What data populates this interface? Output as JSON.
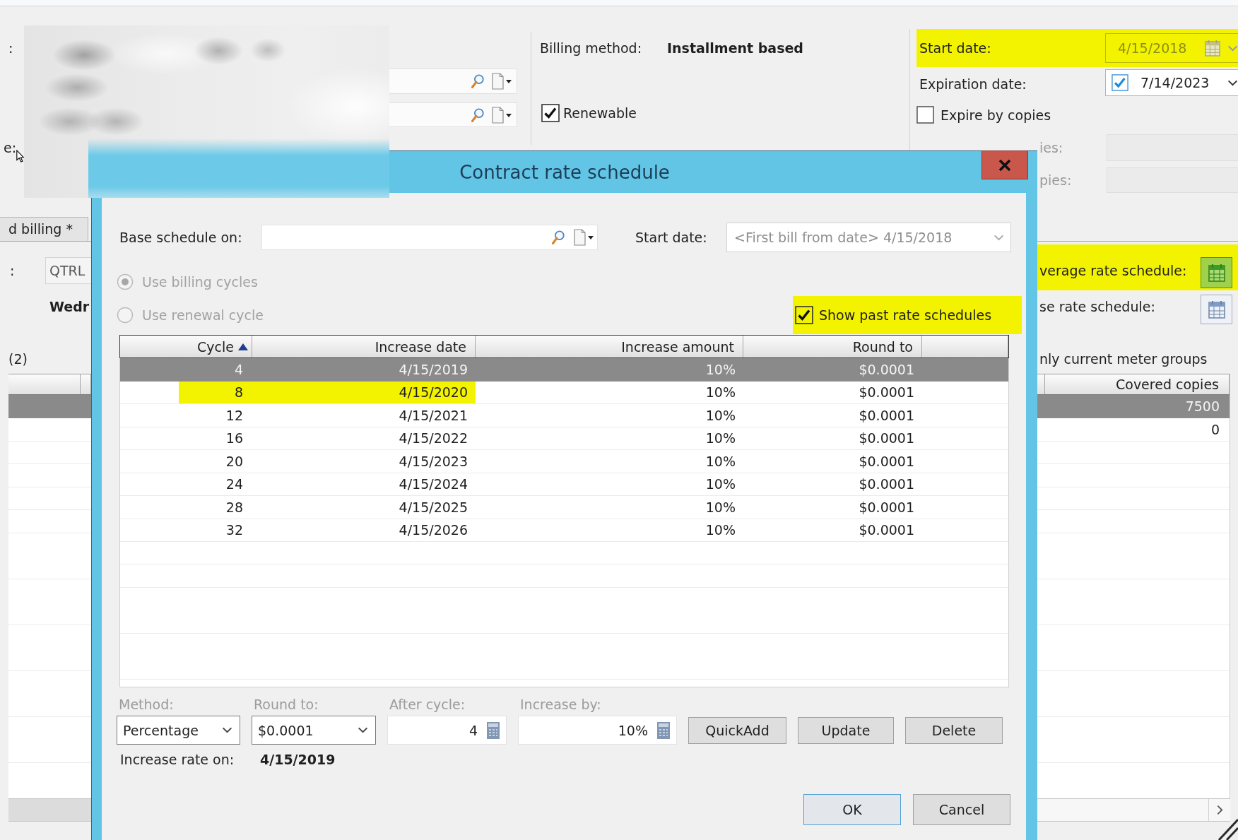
{
  "contract_form": {
    "label_fragments": [
      ":",
      "e:"
    ],
    "billing_method": {
      "label": "Billing method:",
      "value": "Installment based"
    },
    "renewable": {
      "label": "Renewable",
      "checked": true
    },
    "start_date": {
      "label": "Start date:",
      "value": "4/15/2018",
      "disabled": true,
      "highlighted": true
    },
    "expiration_date": {
      "label": "Expiration date:",
      "value": "7/14/2023",
      "checked": true
    },
    "expire_by_copies": {
      "label": "Expire by copies",
      "checked": false
    },
    "copies_fields": [
      {
        "label": "ies:",
        "disabled": true
      },
      {
        "label": "pies:",
        "disabled": true
      }
    ],
    "tabs": [
      {
        "label": "d billing *",
        "selected": false
      }
    ],
    "schedule": {
      "label": ":",
      "value": "QTRL"
    },
    "day": "Wedr",
    "meter_groups_count": "(2)",
    "coverage_rate_schedule": {
      "label": "verage rate schedule:",
      "highlighted": true
    },
    "increase_rate_schedule": {
      "label": "se rate schedule:"
    },
    "current_meter_groups": "nly current meter groups",
    "meter_groups_table": {
      "columns": [
        "Covered copies"
      ],
      "rows": [
        {
          "cells": [
            "7500"
          ],
          "selected": true
        },
        {
          "cells": [
            "0"
          ],
          "selected": false
        }
      ]
    }
  },
  "dialog": {
    "title": "Contract rate schedule",
    "base_schedule_on": {
      "label": "Base schedule on:"
    },
    "start_date": {
      "label": "Start date:",
      "value": "<First bill from date> 4/15/2018",
      "disabled": true
    },
    "basis_options": [
      {
        "label": "Use billing cycles",
        "selected": true,
        "disabled": true
      },
      {
        "label": "Use renewal cycle",
        "selected": false,
        "disabled": true
      }
    ],
    "show_past_rate_schedules": {
      "label": "Show past rate schedules",
      "checked": true,
      "highlighted": true
    },
    "table": {
      "columns": [
        {
          "label": "Cycle",
          "sorted": true
        },
        {
          "label": "Increase date",
          "sorted": false
        },
        {
          "label": "Increase amount",
          "sorted": false
        },
        {
          "label": "Round to",
          "sorted": false
        }
      ],
      "rows": [
        {
          "cells": [
            "4",
            "4/15/2019",
            "10%",
            "$0.0001"
          ],
          "selected": true,
          "highlighted": false
        },
        {
          "cells": [
            "8",
            "4/15/2020",
            "10%",
            "$0.0001"
          ],
          "selected": false,
          "highlighted": true
        },
        {
          "cells": [
            "12",
            "4/15/2021",
            "10%",
            "$0.0001"
          ],
          "selected": false,
          "highlighted": false
        },
        {
          "cells": [
            "16",
            "4/15/2022",
            "10%",
            "$0.0001"
          ],
          "selected": false,
          "highlighted": false
        },
        {
          "cells": [
            "20",
            "4/15/2023",
            "10%",
            "$0.0001"
          ],
          "selected": false,
          "highlighted": false
        },
        {
          "cells": [
            "24",
            "4/15/2024",
            "10%",
            "$0.0001"
          ],
          "selected": false,
          "highlighted": false
        },
        {
          "cells": [
            "28",
            "4/15/2025",
            "10%",
            "$0.0001"
          ],
          "selected": false,
          "highlighted": false
        },
        {
          "cells": [
            "32",
            "4/15/2026",
            "10%",
            "$0.0001"
          ],
          "selected": false,
          "highlighted": false
        }
      ]
    },
    "method": {
      "label": "Method:",
      "value": "Percentage"
    },
    "round_to": {
      "label": "Round to:",
      "value": "$0.0001"
    },
    "after_cycle": {
      "label": "After cycle:",
      "value": "4"
    },
    "increase_by": {
      "label": "Increase by:",
      "value": "10%"
    },
    "action_buttons": [
      "QuickAdd",
      "Update",
      "Delete"
    ],
    "increase_rate_on": {
      "label": "Increase rate on:",
      "value": "4/15/2019"
    },
    "buttons": [
      {
        "label": "OK",
        "default": true
      },
      {
        "label": "Cancel",
        "default": false
      }
    ]
  }
}
